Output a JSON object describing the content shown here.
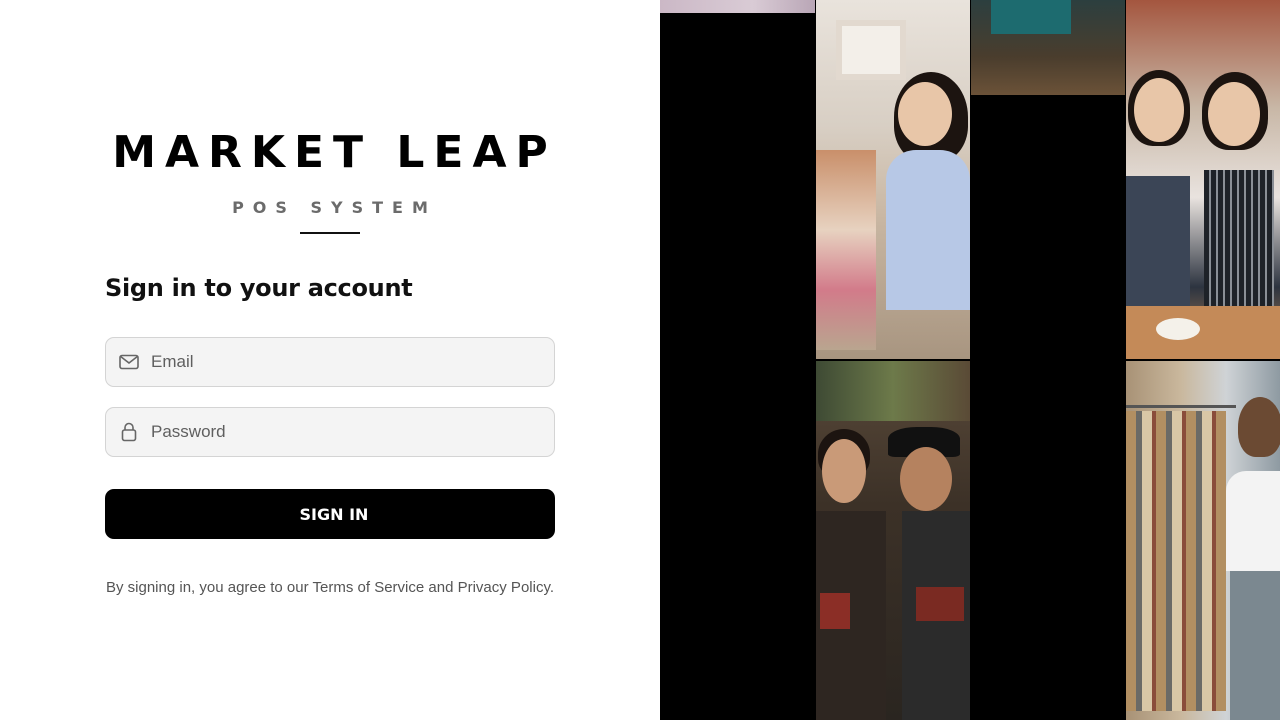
{
  "brand": {
    "title": "MARKET LEAP",
    "subtitle": "POS SYSTEM"
  },
  "form": {
    "heading": "Sign in to your account",
    "email_placeholder": "Email",
    "password_placeholder": "Password",
    "submit_label": "SIGN IN",
    "terms_prefix": "By signing in, you agree to our ",
    "terms_link": "Terms of Service",
    "terms_and": " and ",
    "privacy_link": "Privacy Policy",
    "terms_suffix": "."
  },
  "icons": {
    "email": "mail-icon",
    "password": "lock-icon"
  },
  "colors": {
    "primary_button": "#000000",
    "input_background": "#f4f4f4",
    "subtitle": "#6b6b6b"
  }
}
